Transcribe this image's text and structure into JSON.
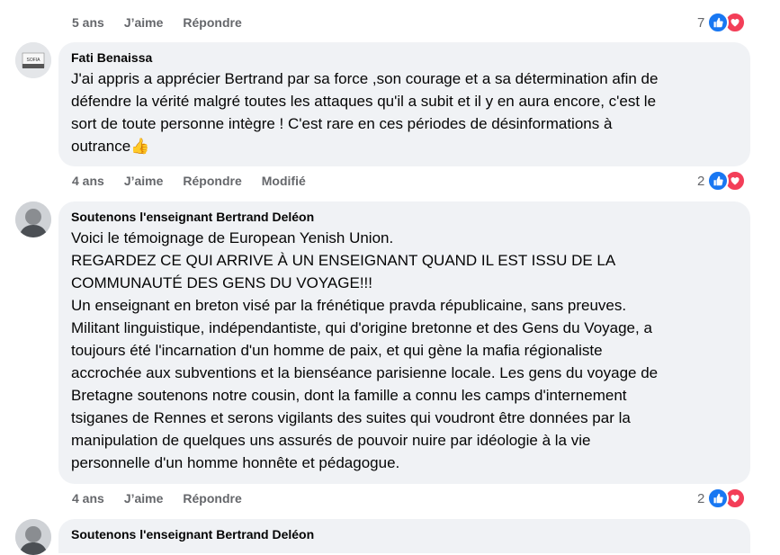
{
  "top_actions": {
    "time": "5 ans",
    "like": "J’aime",
    "reply": "Répondre",
    "reaction_count": "7"
  },
  "comments": [
    {
      "author": "Fati Benaissa",
      "avatar_text": "SOFIA",
      "lines": [
        "J'ai appris a apprécier Bertrand par sa force ,son courage et a sa détermination afin de",
        "défendre la vérité malgré toutes les attaques qu'il a subit et il y en aura encore, c'est le",
        "sort de toute personne intègre ! C'est rare en ces périodes de désinformations à",
        "outrance"
      ],
      "emoji": "👍",
      "actions": {
        "time": "4 ans",
        "like": "J’aime",
        "reply": "Répondre",
        "edited": "Modifié"
      },
      "reaction_count": "2"
    },
    {
      "author": "Soutenons l'enseignant Bertrand Deléon",
      "lines": [
        "Voici le témoignage de European Yenish Union.",
        "REGARDEZ CE QUI ARRIVE À UN ENSEIGNANT QUAND IL EST ISSU DE LA",
        "COMMUNAUTÉ DES GENS DU VOYAGE!!!",
        "Un enseignant en breton visé par la frénétique pravda républicaine, sans preuves.",
        "Militant linguistique, indépendantiste, qui d'origine bretonne et des Gens du Voyage, a",
        "toujours été l'incarnation d'un homme de paix, et qui gène la mafia régionaliste",
        "accrochée aux subventions et la bienséance parisienne locale. Les gens du voyage de",
        "Bretagne soutenons notre cousin, dont la famille a connu les camps d'internement",
        "tsiganes de Rennes et serons vigilants des suites qui voudront être données par la",
        "manipulation de quelques uns assurés de pouvoir nuire par idéologie à la vie",
        "personnelle d'un homme honnête et pédagogue."
      ],
      "actions": {
        "time": "4 ans",
        "like": "J’aime",
        "reply": "Répondre"
      },
      "reaction_count": "2"
    },
    {
      "author": "Soutenons l'enseignant Bertrand Deléon"
    }
  ],
  "colors": {
    "bubble": "#f0f2f5",
    "meta": "#65676b",
    "like": "#1877f2",
    "love": "#f33e58"
  },
  "icons": {
    "like": "thumbs-up-icon",
    "love": "heart-icon"
  }
}
